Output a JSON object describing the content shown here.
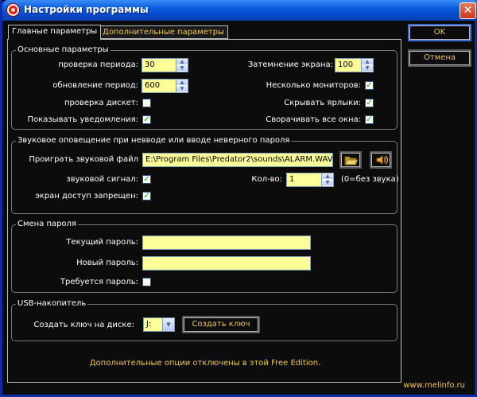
{
  "window": {
    "title": "Настройки программы",
    "close_symbol": "✕"
  },
  "tabs": [
    {
      "label": "Главные параметры",
      "active": true
    },
    {
      "label": "Дополнительные параметры",
      "active": false
    }
  ],
  "actions": {
    "ok_label": "OK",
    "cancel_label": "Отмена"
  },
  "basic": {
    "legend": "Основные параметры",
    "check_period_label": "проверка периода:",
    "check_period_value": "30",
    "update_period_label": "обновление период:",
    "update_period_value": "600",
    "check_floppy_label": "проверка дискет:",
    "check_floppy_checked": false,
    "show_notifications_label": "Показывать уведомления:",
    "show_notifications_checked": true,
    "dim_screen_label": "Затемнение экрана:",
    "dim_screen_value": "100",
    "multi_monitors_label": "Несколько мониторов:",
    "multi_monitors_checked": true,
    "hide_shortcuts_label": "Скрывать ярлыки:",
    "hide_shortcuts_checked": true,
    "minimize_windows_label": "Сворачивать все окна:",
    "minimize_windows_checked": true
  },
  "sound": {
    "legend": "Звуковое оповещение при невводе или вводе неверного пароля",
    "play_file_label": "Проиграть звуковой файл",
    "file_path": "E:\\Program Files\\Predator2\\sounds\\ALARM.WAV",
    "open_icon": "folder-open-icon",
    "play_icon": "speaker-icon",
    "beep_label": "звуковой сигнал:",
    "beep_checked": true,
    "screen_denied_label": "экран доступ запрещен:",
    "screen_denied_checked": true,
    "count_label": "Кол-во:",
    "count_value": "1",
    "count_hint": "(0=без звука)"
  },
  "password": {
    "legend": "Смена пароля",
    "current_label": "Текущий пароль:",
    "current_value": "",
    "new_label": "Новый пароль:",
    "new_value": "",
    "required_label": "Требуется пароль:",
    "required_checked": false
  },
  "usb": {
    "legend": "USB-накопитель",
    "create_on_disk_label": "Создать ключ на диске:",
    "drive_value": "J:",
    "create_key_button": "Создать ключ"
  },
  "footer": {
    "note": "Дополнительные опции отключены в этой Free Edition.",
    "site": "www.melinfo.ru"
  },
  "colors": {
    "accent_text": "#f2c94c",
    "field_bg": "#ffff99",
    "titlebar": "#0a5ce0",
    "background": "#0c0c0c",
    "check_mark": "#21a121"
  }
}
